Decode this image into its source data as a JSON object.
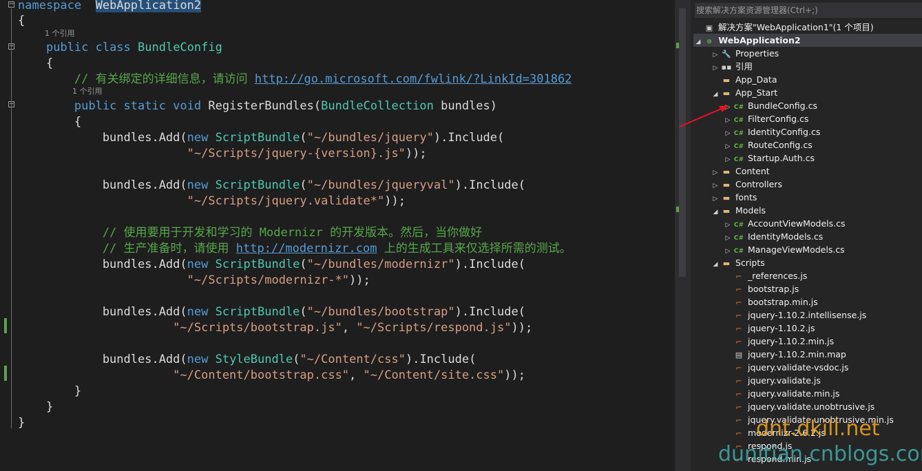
{
  "editor": {
    "codelens": [
      "1 个引用",
      "1 个引用"
    ],
    "lines": [
      {
        "parts": [
          [
            "kw",
            "namespace"
          ],
          [
            "",
            "  "
          ],
          [
            "hl",
            "WebApplication2"
          ]
        ]
      },
      {
        "parts": [
          [
            "",
            "{"
          ]
        ]
      },
      {
        "parts": [
          [
            "",
            "    "
          ],
          [
            "kw",
            "public class "
          ],
          [
            "ty",
            "BundleConfig"
          ]
        ]
      },
      {
        "parts": [
          [
            "",
            "    {"
          ]
        ]
      },
      {
        "parts": [
          [
            "",
            "        "
          ],
          [
            "cm",
            "// 有关绑定的详细信息，请访问 "
          ],
          [
            "lk",
            "http://go.microsoft.com/fwlink/?LinkId=301862"
          ]
        ]
      },
      {
        "parts": [
          [
            "",
            "        "
          ],
          [
            "kw",
            "public static void "
          ],
          [
            "",
            "RegisterBundles("
          ],
          [
            "ty",
            "BundleCollection"
          ],
          [
            "",
            " bundles)"
          ]
        ]
      },
      {
        "parts": [
          [
            "",
            "        {"
          ]
        ]
      },
      {
        "parts": [
          [
            "",
            "            bundles.Add("
          ],
          [
            "kw",
            "new "
          ],
          [
            "ty",
            "ScriptBundle"
          ],
          [
            "",
            "("
          ],
          [
            "st",
            "\"~/bundles/jquery\""
          ],
          [
            "",
            ").Include("
          ]
        ]
      },
      {
        "parts": [
          [
            "",
            "                        "
          ],
          [
            "st",
            "\"~/Scripts/jquery-{version}.js\""
          ],
          [
            "",
            "));"
          ]
        ]
      },
      {
        "parts": [
          [
            "",
            ""
          ]
        ]
      },
      {
        "parts": [
          [
            "",
            "            bundles.Add("
          ],
          [
            "kw",
            "new "
          ],
          [
            "ty",
            "ScriptBundle"
          ],
          [
            "",
            "("
          ],
          [
            "st",
            "\"~/bundles/jqueryval\""
          ],
          [
            "",
            ").Include("
          ]
        ]
      },
      {
        "parts": [
          [
            "",
            "                        "
          ],
          [
            "st",
            "\"~/Scripts/jquery.validate*\""
          ],
          [
            "",
            "));"
          ]
        ]
      },
      {
        "parts": [
          [
            "",
            ""
          ]
        ]
      },
      {
        "parts": [
          [
            "",
            "            "
          ],
          [
            "cm",
            "// 使用要用于开发和学习的 Modernizr 的开发版本。然后，当你做好"
          ]
        ]
      },
      {
        "parts": [
          [
            "",
            "            "
          ],
          [
            "cm",
            "// 生产准备时，请使用 "
          ],
          [
            "lk",
            "http://modernizr.com"
          ],
          [
            "cm",
            " 上的生成工具来仅选择所需的测试。"
          ]
        ]
      },
      {
        "parts": [
          [
            "",
            "            bundles.Add("
          ],
          [
            "kw",
            "new "
          ],
          [
            "ty",
            "ScriptBundle"
          ],
          [
            "",
            "("
          ],
          [
            "st",
            "\"~/bundles/modernizr\""
          ],
          [
            "",
            ").Include("
          ]
        ]
      },
      {
        "parts": [
          [
            "",
            "                        "
          ],
          [
            "st",
            "\"~/Scripts/modernizr-*\""
          ],
          [
            "",
            "));"
          ]
        ]
      },
      {
        "parts": [
          [
            "",
            ""
          ]
        ]
      },
      {
        "parts": [
          [
            "",
            "            bundles.Add("
          ],
          [
            "kw",
            "new "
          ],
          [
            "ty",
            "ScriptBundle"
          ],
          [
            "",
            "("
          ],
          [
            "st",
            "\"~/bundles/bootstrap\""
          ],
          [
            "",
            ").Include("
          ]
        ]
      },
      {
        "parts": [
          [
            "",
            "                      "
          ],
          [
            "st",
            "\"~/Scripts/bootstrap.js\""
          ],
          [
            "",
            ", "
          ],
          [
            "st",
            "\"~/Scripts/respond.js\""
          ],
          [
            "",
            "));"
          ]
        ]
      },
      {
        "parts": [
          [
            "",
            ""
          ]
        ]
      },
      {
        "parts": [
          [
            "",
            "            bundles.Add("
          ],
          [
            "kw",
            "new "
          ],
          [
            "ty",
            "StyleBundle"
          ],
          [
            "",
            "("
          ],
          [
            "st",
            "\"~/Content/css\""
          ],
          [
            "",
            ").Include("
          ]
        ]
      },
      {
        "parts": [
          [
            "",
            "                      "
          ],
          [
            "st",
            "\"~/Content/bootstrap.css\""
          ],
          [
            "",
            ", "
          ],
          [
            "st",
            "\"~/Content/site.css\""
          ],
          [
            "",
            "));"
          ]
        ]
      },
      {
        "parts": [
          [
            "",
            "        }"
          ]
        ]
      },
      {
        "parts": [
          [
            "",
            "    }"
          ]
        ]
      },
      {
        "parts": [
          [
            "",
            "}"
          ]
        ]
      }
    ]
  },
  "solution_explorer": {
    "search_placeholder": "搜索解决方案资源管理器(Ctrl+;)",
    "items": [
      {
        "label": "解决方案\"WebApplication1\"(1 个项目)",
        "icon": "solution-icon",
        "level": 0,
        "arrow": ""
      },
      {
        "label": "WebApplication2",
        "icon": "web-project-icon",
        "level": 0,
        "arrow": "◢",
        "bold": true
      },
      {
        "label": "Properties",
        "icon": "wrench-icon",
        "level": 1,
        "arrow": "▷"
      },
      {
        "label": "引用",
        "icon": "references-icon",
        "level": 1,
        "arrow": "▷"
      },
      {
        "label": "App_Data",
        "icon": "folder-icon",
        "level": 1,
        "arrow": ""
      },
      {
        "label": "App_Start",
        "icon": "folder-open-icon",
        "level": 1,
        "arrow": "◢"
      },
      {
        "label": "BundleConfig.cs",
        "icon": "csharp-file-icon",
        "level": 2,
        "arrow": "▷"
      },
      {
        "label": "FilterConfig.cs",
        "icon": "csharp-file-icon",
        "level": 2,
        "arrow": "▷"
      },
      {
        "label": "IdentityConfig.cs",
        "icon": "csharp-file-icon",
        "level": 2,
        "arrow": "▷"
      },
      {
        "label": "RouteConfig.cs",
        "icon": "csharp-file-icon",
        "level": 2,
        "arrow": "▷"
      },
      {
        "label": "Startup.Auth.cs",
        "icon": "csharp-file-icon",
        "level": 2,
        "arrow": "▷"
      },
      {
        "label": "Content",
        "icon": "folder-icon",
        "level": 1,
        "arrow": "▷"
      },
      {
        "label": "Controllers",
        "icon": "folder-icon",
        "level": 1,
        "arrow": "▷"
      },
      {
        "label": "fonts",
        "icon": "folder-icon",
        "level": 1,
        "arrow": "▷"
      },
      {
        "label": "Models",
        "icon": "folder-open-icon",
        "level": 1,
        "arrow": "◢"
      },
      {
        "label": "AccountViewModels.cs",
        "icon": "csharp-file-icon",
        "level": 2,
        "arrow": "▷"
      },
      {
        "label": "IdentityModels.cs",
        "icon": "csharp-file-icon",
        "level": 2,
        "arrow": "▷"
      },
      {
        "label": "ManageViewModels.cs",
        "icon": "csharp-file-icon",
        "level": 2,
        "arrow": "▷"
      },
      {
        "label": "Scripts",
        "icon": "folder-open-icon",
        "level": 1,
        "arrow": "◢"
      },
      {
        "label": "_references.js",
        "icon": "js-file-icon",
        "level": 2,
        "arrow": ""
      },
      {
        "label": "bootstrap.js",
        "icon": "js-file-icon",
        "level": 2,
        "arrow": ""
      },
      {
        "label": "bootstrap.min.js",
        "icon": "js-file-icon",
        "level": 2,
        "arrow": ""
      },
      {
        "label": "jquery-1.10.2.intellisense.js",
        "icon": "js-file-icon",
        "level": 2,
        "arrow": ""
      },
      {
        "label": "jquery-1.10.2.js",
        "icon": "js-file-icon",
        "level": 2,
        "arrow": ""
      },
      {
        "label": "jquery-1.10.2.min.js",
        "icon": "js-file-icon",
        "level": 2,
        "arrow": ""
      },
      {
        "label": "jquery-1.10.2.min.map",
        "icon": "map-file-icon",
        "level": 2,
        "arrow": ""
      },
      {
        "label": "jquery.validate-vsdoc.js",
        "icon": "js-file-icon",
        "level": 2,
        "arrow": ""
      },
      {
        "label": "jquery.validate.js",
        "icon": "js-file-icon",
        "level": 2,
        "arrow": ""
      },
      {
        "label": "jquery.validate.min.js",
        "icon": "js-file-icon",
        "level": 2,
        "arrow": ""
      },
      {
        "label": "jquery.validate.unobtrusive.js",
        "icon": "js-file-icon",
        "level": 2,
        "arrow": ""
      },
      {
        "label": "jquery.validate.unobtrusive.min.js",
        "icon": "js-file-icon",
        "level": 2,
        "arrow": ""
      },
      {
        "label": "modernizr-2.6.2.js",
        "icon": "js-file-icon",
        "level": 2,
        "arrow": ""
      },
      {
        "label": "respond.js",
        "icon": "js-file-icon",
        "level": 2,
        "arrow": ""
      },
      {
        "label": "respond.min.js",
        "icon": "js-file-icon",
        "level": 2,
        "arrow": ""
      }
    ]
  },
  "watermark": {
    "line1": "dnt.dkill.net",
    "line2": "dunitian.cnblogs.com"
  },
  "colors": {
    "arrow": "#e81123",
    "accent": "#007acc"
  }
}
